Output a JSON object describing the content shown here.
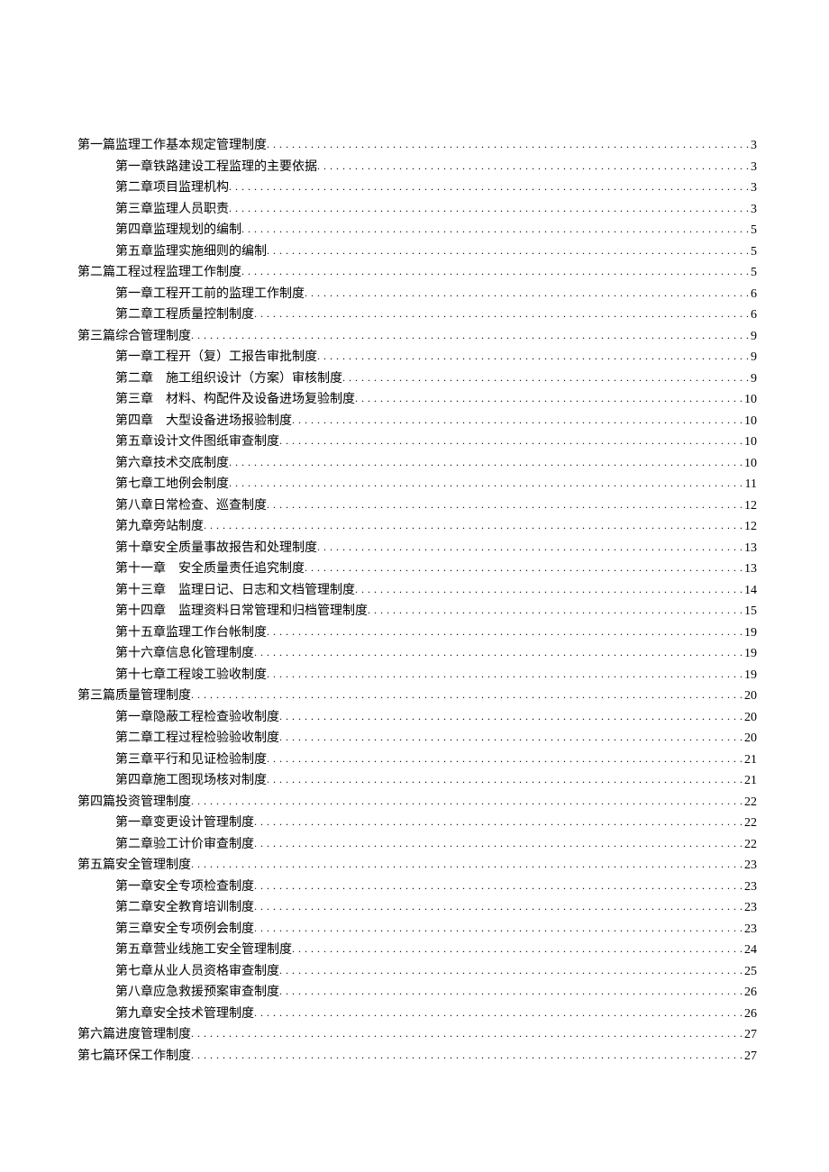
{
  "toc": [
    {
      "level": 0,
      "title": "第一篇监理工作基本规定管理制度",
      "page": "3"
    },
    {
      "level": 1,
      "title": "第一章铁路建设工程监理的主要依据",
      "page": "3"
    },
    {
      "level": 1,
      "title": "第二章项目监理机构",
      "page": "3"
    },
    {
      "level": 1,
      "title": "第三章监理人员职责",
      "page": "3"
    },
    {
      "level": 1,
      "title": "第四章监理规划的编制",
      "page": "5"
    },
    {
      "level": 1,
      "title": "第五章监理实施细则的编制",
      "page": "5"
    },
    {
      "level": 0,
      "title": "第二篇工程过程监理工作制度",
      "page": "5"
    },
    {
      "level": 1,
      "title": "第一章工程开工前的监理工作制度",
      "page": "6"
    },
    {
      "level": 1,
      "title": "第二章工程质量控制制度",
      "page": "6"
    },
    {
      "level": 0,
      "title": "第三篇综合管理制度",
      "page": "9"
    },
    {
      "level": 1,
      "title": "第一章工程开（复）工报告审批制度",
      "page": "9"
    },
    {
      "level": 1,
      "title": "第二章　施工组织设计（方案）审核制度",
      "page": "9"
    },
    {
      "level": 1,
      "title": "第三章　材料、构配件及设备进场复验制度",
      "page": "10"
    },
    {
      "level": 1,
      "title": "第四章　大型设备进场报验制度",
      "page": "10"
    },
    {
      "level": 1,
      "title": "第五章设计文件图纸审查制度",
      "page": "10"
    },
    {
      "level": 1,
      "title": "第六章技术交底制度",
      "page": "10"
    },
    {
      "level": 1,
      "title": "第七章工地例会制度",
      "page": "11"
    },
    {
      "level": 1,
      "title": "第八章日常检查、巡查制度",
      "page": "12"
    },
    {
      "level": 1,
      "title": "第九章旁站制度",
      "page": "12"
    },
    {
      "level": 1,
      "title": "第十章安全质量事故报告和处理制度",
      "page": "13"
    },
    {
      "level": 1,
      "title": "第十一章　安全质量责任追究制度",
      "page": "13"
    },
    {
      "level": 1,
      "title": "第十三章　监理日记、日志和文档管理制度",
      "page": "14"
    },
    {
      "level": 1,
      "title": "第十四章　监理资料日常管理和归档管理制度",
      "page": "15"
    },
    {
      "level": 1,
      "title": "第十五章监理工作台帐制度",
      "page": "19"
    },
    {
      "level": 1,
      "title": "第十六章信息化管理制度",
      "page": "19"
    },
    {
      "level": 1,
      "title": "第十七章工程竣工验收制度",
      "page": "19"
    },
    {
      "level": 0,
      "title": "第三篇质量管理制度",
      "page": "20"
    },
    {
      "level": 1,
      "title": "第一章隐蔽工程检查验收制度",
      "page": "20"
    },
    {
      "level": 1,
      "title": "第二章工程过程检验验收制度",
      "page": "20"
    },
    {
      "level": 1,
      "title": "第三章平行和见证检验制度",
      "page": "21"
    },
    {
      "level": 1,
      "title": "第四章施工图现场核对制度",
      "page": "21"
    },
    {
      "level": 0,
      "title": "第四篇投资管理制度",
      "page": "22"
    },
    {
      "level": 1,
      "title": "第一章变更设计管理制度",
      "page": "22"
    },
    {
      "level": 1,
      "title": "第二章验工计价审查制度",
      "page": "22"
    },
    {
      "level": 0,
      "title": "第五篇安全管理制度",
      "page": "23"
    },
    {
      "level": 1,
      "title": "第一章安全专项检查制度",
      "page": "23"
    },
    {
      "level": 1,
      "title": "第二章安全教育培训制度",
      "page": "23"
    },
    {
      "level": 1,
      "title": "第三章安全专项例会制度",
      "page": "23"
    },
    {
      "level": 1,
      "title": "第五章营业线施工安全管理制度",
      "page": "24"
    },
    {
      "level": 1,
      "title": "第七章从业人员资格审查制度",
      "page": "25"
    },
    {
      "level": 1,
      "title": "第八章应急救援预案审查制度",
      "page": "26"
    },
    {
      "level": 1,
      "title": "第九章安全技术管理制度",
      "page": "26"
    },
    {
      "level": 0,
      "title": "第六篇进度管理制度",
      "page": "27"
    },
    {
      "level": 0,
      "title": "第七篇环保工作制度",
      "page": "27"
    }
  ]
}
